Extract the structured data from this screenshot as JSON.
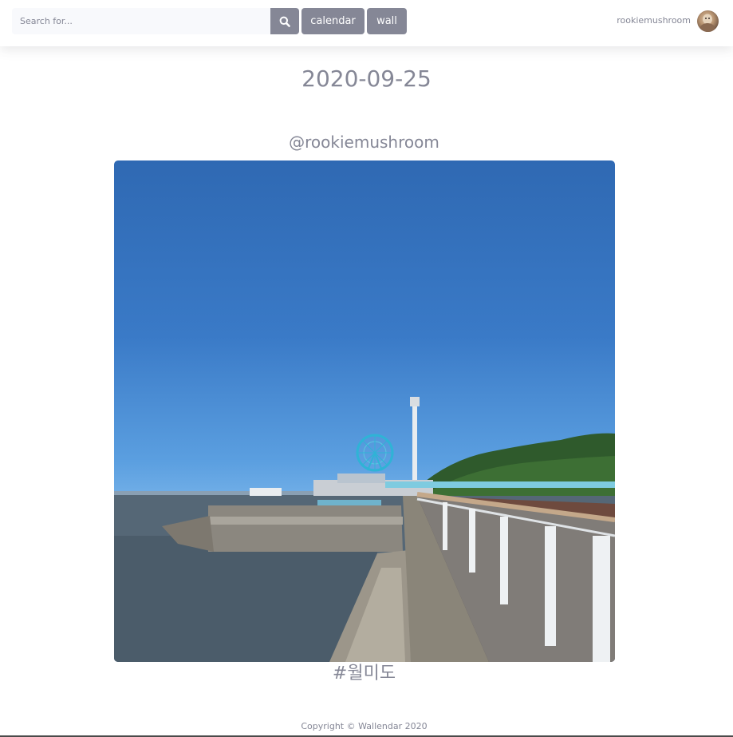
{
  "search": {
    "placeholder": "Search for...",
    "button_icon": "search-icon"
  },
  "nav": {
    "calendar_label": "calendar",
    "wall_label": "wall"
  },
  "user": {
    "name": "rookiemushroom",
    "avatar_icon": "avatar"
  },
  "page": {
    "date": "2020-09-25"
  },
  "post": {
    "author": "@rookiemushroom",
    "tag": "#월미도"
  },
  "footer": {
    "copyright": "Copyright © Wallendar 2020"
  },
  "colors": {
    "accent": "#858796",
    "search_bg": "#f8f9fc",
    "background": "#ffffff"
  }
}
